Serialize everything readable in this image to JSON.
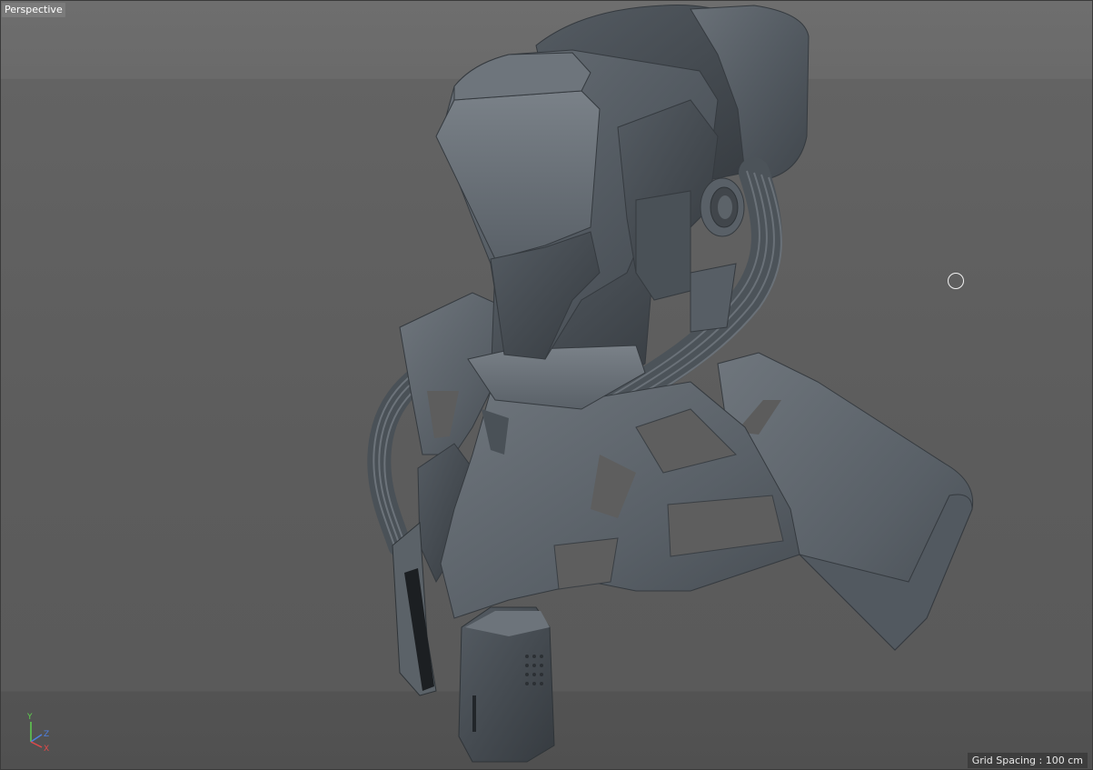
{
  "viewport": {
    "view_label": "Perspective",
    "grid_spacing_label": "Grid Spacing : ",
    "grid_spacing_value": "100 cm"
  },
  "axis_gizmo": {
    "y_label": "Y",
    "z_label": "Z",
    "x_label": "X",
    "y_color": "#5fcf4f",
    "z_color": "#4f7fe0",
    "x_color": "#e04a4a"
  },
  "model": {
    "icon": "sci-fi-armor-bust-model",
    "shade_color": "#4e555c"
  },
  "cursor": {
    "icon": "circle-cursor-icon"
  }
}
